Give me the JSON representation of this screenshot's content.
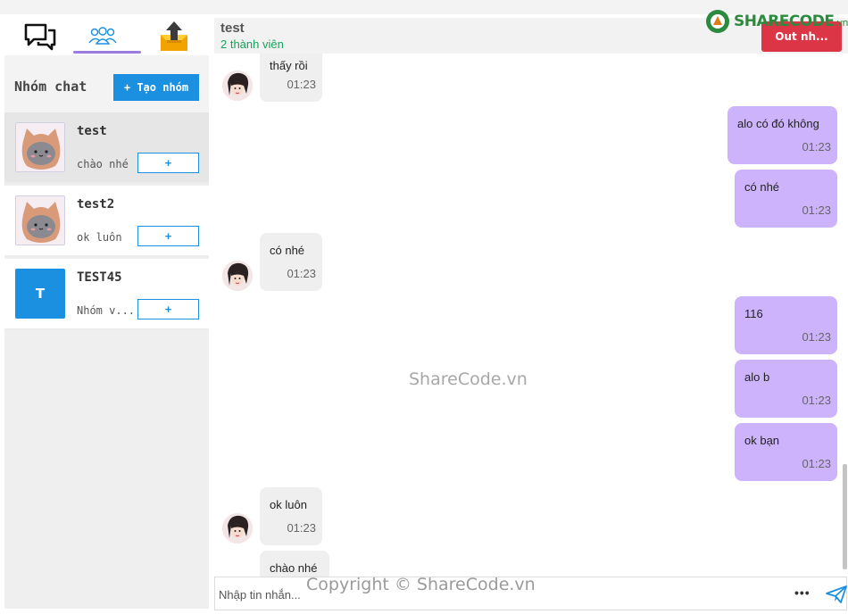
{
  "sidebar": {
    "tabs": [
      {
        "icon": "chat-bubbles-icon"
      },
      {
        "icon": "group-icon",
        "active": true
      },
      {
        "icon": "upload-box-icon"
      }
    ],
    "group_title": "Nhóm chat",
    "create_label": "+ Tạo nhóm",
    "conversations": [
      {
        "name": "test",
        "last": "chào nhé",
        "plus": "+",
        "avatar": "cat-avatar"
      },
      {
        "name": "test2",
        "last": "ok luôn",
        "plus": "+",
        "avatar": "cat-avatar"
      },
      {
        "name": "TEST45",
        "last": "Nhóm v...",
        "plus": "+",
        "avatar_letter": "T"
      }
    ]
  },
  "chat": {
    "title": "test",
    "subtitle": "2 thành viên",
    "out_label": "Out nh...",
    "messages": [
      {
        "dir": "in",
        "text": "thấy rồi",
        "time": "01:23"
      },
      {
        "dir": "out",
        "text": "alo có đó không",
        "time": "01:23"
      },
      {
        "dir": "out",
        "text": "có nhé",
        "time": "01:23"
      },
      {
        "dir": "in",
        "text": "có nhé",
        "time": "01:23"
      },
      {
        "dir": "out",
        "text": "116",
        "time": "01:23"
      },
      {
        "dir": "out",
        "text": "alo b",
        "time": "01:23"
      },
      {
        "dir": "out",
        "text": "ok bạn",
        "time": "01:23"
      },
      {
        "dir": "in",
        "text": "ok luôn",
        "time": "01:23"
      },
      {
        "dir": "in",
        "text": "chào nhé",
        "time": ""
      }
    ],
    "input_placeholder": "Nhập tin nhắn...",
    "more_label": "•••"
  },
  "logo": {
    "main": "SHARECODE",
    "domain": ".vn"
  },
  "watermarks": {
    "center": "ShareCode.vn",
    "footer": "Copyright © ShareCode.vn"
  },
  "colors": {
    "accent": "#1b8fe0",
    "outgoing": "#cdb3fb",
    "incoming": "#efefef",
    "danger": "#dc3545",
    "online": "#1aa05a"
  }
}
